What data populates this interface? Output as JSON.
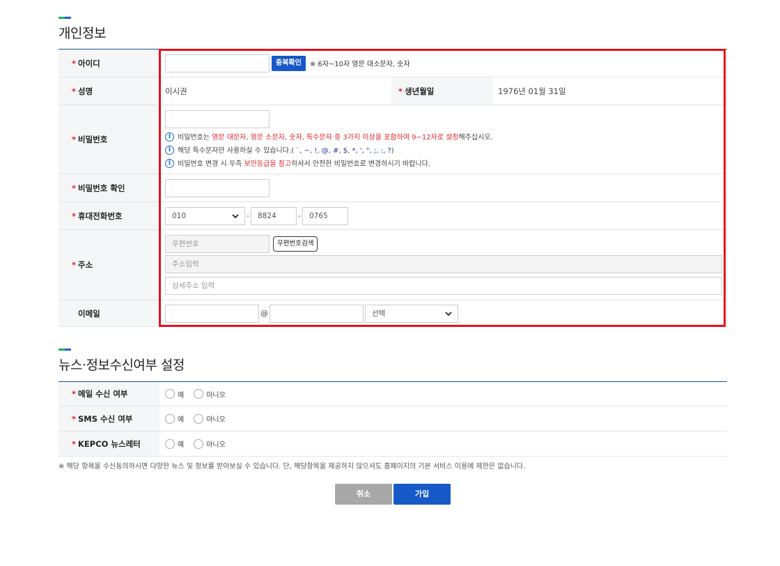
{
  "section1": {
    "title": "개인정보"
  },
  "id_row": {
    "label": "아이디",
    "button": "중복확인",
    "hint": "※ 6자~10자 영문 대소문자, 숫자"
  },
  "name_row": {
    "label": "성명",
    "value": "이시권",
    "birth_label": "생년월일",
    "birth_value": "1976년 01월 31일"
  },
  "pw_row": {
    "label": "비밀번호",
    "line1": {
      "a": "비밀번호는 ",
      "b": "영문 대문자, 영문 소문자, 숫자, 특수문자 중 3가지 이상을 포함하여 9~12자로 설정",
      "c": "해주십시오."
    },
    "line2": {
      "a": "해당 특수문자만 사용하실 수 있습니다.( ",
      "b": "`, ~, !, @, #, $, *, ', \", ;, :, ?",
      "c": ")"
    },
    "line3": {
      "a": "비밀번호 변경 시 우측 ",
      "b": "보안등급을 참고",
      "c": "하셔서 안전한 비밀번호로 변경하시기 바랍니다."
    }
  },
  "pw_confirm_row": {
    "label": "비밀번호 확인"
  },
  "phone_row": {
    "label": "휴대전화번호",
    "prefix": "010",
    "mid": "8824",
    "last": "0765",
    "dash": "-"
  },
  "address_row": {
    "label": "주소",
    "zip_placeholder": "우편번호",
    "zip_button": "우편번호검색",
    "addr_placeholder": "주소입력",
    "detail_placeholder": "상세주소 입력"
  },
  "email_row": {
    "label": "이메일",
    "at": "@",
    "select": "선택"
  },
  "section2": {
    "title": "뉴스·정보수신여부 설정"
  },
  "news_rows": [
    {
      "label": "메일 수신 여부",
      "yes": "예",
      "no": "아니오"
    },
    {
      "label": "SMS 수신 여부",
      "yes": "예",
      "no": "아니오"
    },
    {
      "label": "KEPCO 뉴스레터",
      "yes": "예",
      "no": "아니오"
    }
  ],
  "required_mark": "*",
  "note": "※ 해당 항목을 수신동의하시면 다양한 뉴스 및 정보를 받아보실 수 있습니다. 단, 해당항목을 제공하지 않으셔도 홈페이지의 기본 서비스 이용에 제한은 없습니다.",
  "buttons": {
    "cancel": "취소",
    "join": "가입"
  },
  "colors": {
    "primary": "#1659c7",
    "required": "#e0262b",
    "highlight_box": "#e8101a",
    "header_bg": "#f5f6f8"
  }
}
